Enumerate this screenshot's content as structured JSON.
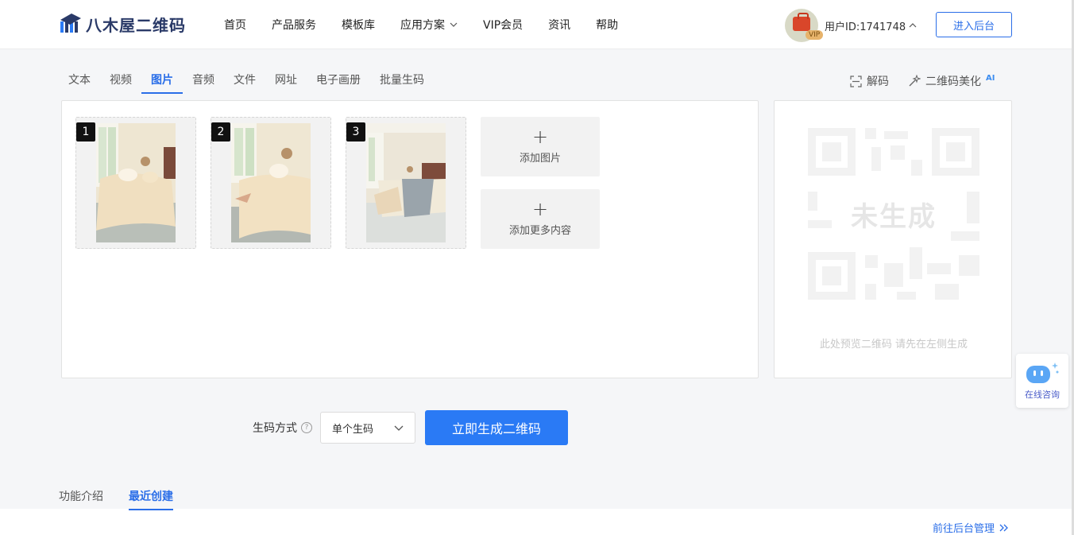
{
  "header": {
    "logo_text": "八木屋二维码",
    "nav": [
      {
        "label": "首页"
      },
      {
        "label": "产品服务"
      },
      {
        "label": "模板库"
      },
      {
        "label": "应用方案"
      },
      {
        "label": "VIP会员"
      },
      {
        "label": "资讯"
      },
      {
        "label": "帮助"
      }
    ],
    "vip_badge": "VIP",
    "user_id": "用户ID:1741748",
    "enter_button": "进入后台"
  },
  "tabs": {
    "items": [
      {
        "label": "文本"
      },
      {
        "label": "视频"
      },
      {
        "label": "图片"
      },
      {
        "label": "音频"
      },
      {
        "label": "文件"
      },
      {
        "label": "网址"
      },
      {
        "label": "电子画册"
      },
      {
        "label": "批量生码"
      }
    ],
    "active": "图片"
  },
  "tools": {
    "decode": "解码",
    "beautify": "二维码美化",
    "ai_tag": "AI"
  },
  "editor": {
    "images": [
      {
        "num": "1"
      },
      {
        "num": "2"
      },
      {
        "num": "3"
      }
    ],
    "add_image": "添加图片",
    "add_more": "添加更多内容"
  },
  "preview": {
    "placeholder_text": "未生成",
    "hint": "此处预览二维码 请先在左侧生成"
  },
  "consult": {
    "label": "在线咨询"
  },
  "generate": {
    "mode_label": "生码方式",
    "mode_value": "单个生码",
    "button": "立即生成二维码"
  },
  "bottom": {
    "tabs": [
      {
        "label": "功能介绍"
      },
      {
        "label": "最近创建"
      }
    ],
    "active": "最近创建",
    "goto_link": "前往后台管理"
  },
  "colors": {
    "accent": "#2a7af5",
    "link": "#2a6ee8"
  }
}
